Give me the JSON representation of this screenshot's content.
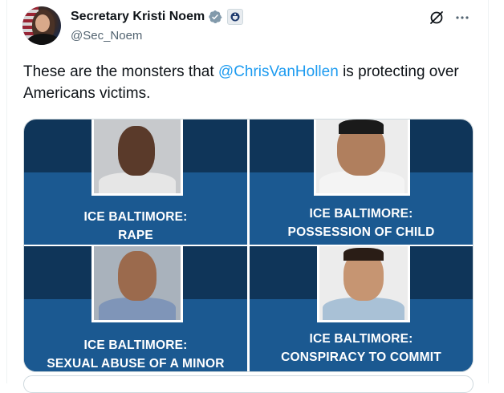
{
  "post": {
    "author_name": "Secretary Kristi Noem",
    "author_handle": "@Sec_Noem",
    "text_before": "These are the monsters that ",
    "mention": "@ChrisVanHollen",
    "text_after": " is protecting over Americans victims."
  },
  "icons": {
    "verified": "verified-badge-icon",
    "affiliate": "dhs-seal-icon",
    "grok": "grok-icon",
    "more": "more-icon"
  },
  "colors": {
    "mention": "#1d9bf0",
    "tile_dark": "#0f3559",
    "tile_band": "#1b5991",
    "verified": "#829aab"
  },
  "media": {
    "tiles": [
      {
        "line1": "ICE BALTIMORE:",
        "line2": "RAPE"
      },
      {
        "line1": "ICE BALTIMORE:",
        "line2": "POSSESSION OF CHILD"
      },
      {
        "line1": "ICE BALTIMORE:",
        "line2": "SEXUAL ABUSE OF A MINOR"
      },
      {
        "line1": "ICE BALTIMORE:",
        "line2": "CONSPIRACY TO COMMIT"
      }
    ]
  }
}
